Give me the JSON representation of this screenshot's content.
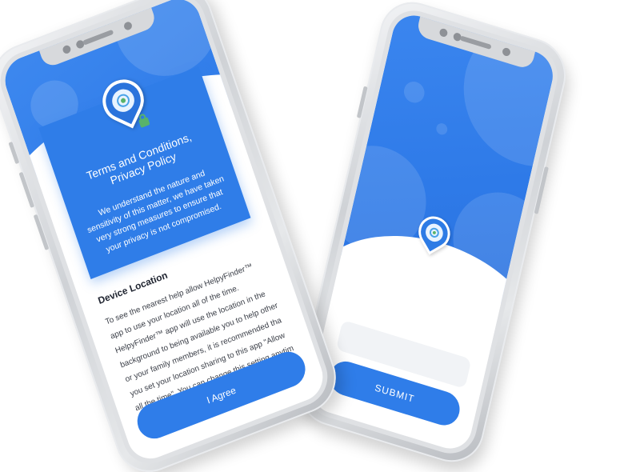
{
  "back_phone": {
    "submit_label": "SUBMIT",
    "field_placeholder": ""
  },
  "front_phone": {
    "card": {
      "title": "Terms and Conditions, Privacy Policy",
      "text": "We understand the nature and sensitivity of this matter, we have taken very strong measures to ensure that your privacy is not compromised."
    },
    "section": {
      "title": "Device Location",
      "text": "To see the nearest help allow HelpyFinder™ app to use your location all of the time. HelpyFinder™ app will use the location in the background to being available you to help other or your family members, it is recommended tha you set your location sharing to this app \"Allow all the time\". You can change this setting anytim"
    },
    "agree_label": "I Agree"
  },
  "icons": [
    "location-pin-icon",
    "lock-icon"
  ],
  "colors": {
    "primary_blue": "#2f7de8",
    "accent_green": "#58b36a",
    "frame_silver": "#cfd2d6"
  }
}
